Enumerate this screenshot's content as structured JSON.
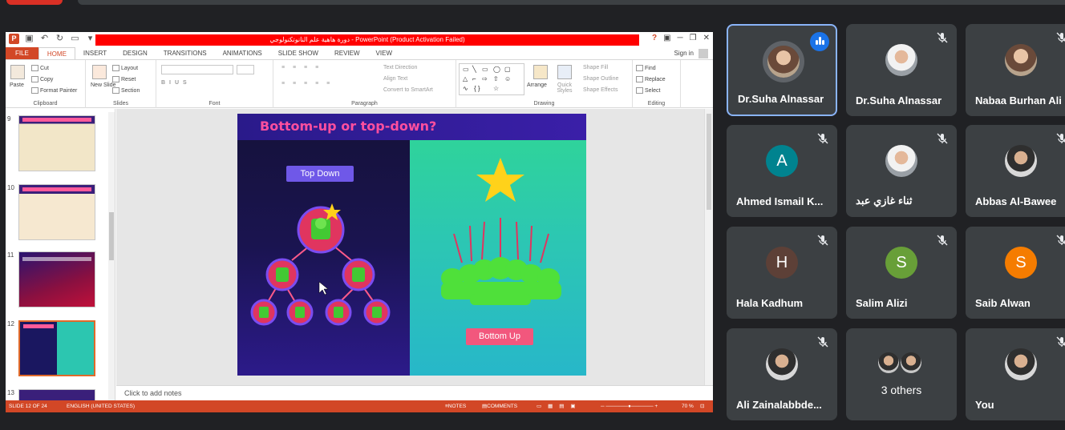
{
  "ppt": {
    "title": "دورة هاهية علم النانوتكنولوجي - PowerPoint (Product Activation Failed)",
    "window_controls": [
      "?",
      "▣",
      "─",
      "❐",
      "✕"
    ],
    "tabs": [
      "FILE",
      "HOME",
      "INSERT",
      "DESIGN",
      "TRANSITIONS",
      "ANIMATIONS",
      "SLIDE SHOW",
      "REVIEW",
      "VIEW"
    ],
    "sign_in": "Sign in",
    "ribbon": {
      "clipboard": {
        "paste": "Paste",
        "cut": "Cut",
        "copy": "Copy",
        "format_painter": "Format Painter",
        "label": "Clipboard"
      },
      "slides": {
        "new_slide": "New Slide",
        "layout": "Layout",
        "reset": "Reset",
        "section": "Section",
        "label": "Slides"
      },
      "font": {
        "label": "Font"
      },
      "paragraph": {
        "text_direction": "Text Direction",
        "align_text": "Align Text",
        "convert": "Convert to SmartArt",
        "label": "Paragraph"
      },
      "drawing": {
        "arrange": "Arrange",
        "quick_styles": "Quick Styles",
        "shape_fill": "Shape Fill",
        "shape_outline": "Shape Outline",
        "shape_effects": "Shape Effects",
        "label": "Drawing"
      },
      "editing": {
        "find": "Find",
        "replace": "Replace",
        "select": "Select",
        "label": "Editing"
      }
    },
    "thumbnails": [
      {
        "num": "9",
        "title": "Classification of Nanomaterials"
      },
      {
        "num": "10",
        "title": "Classification of Nanomaterials"
      },
      {
        "num": "11",
        "title": "Approaches of Nanotechnology"
      },
      {
        "num": "12",
        "title": "Bottom-up or top-down?"
      },
      {
        "num": "13",
        "title": "Types of Nanomaterials"
      }
    ],
    "slide": {
      "title": "Bottom-up or top-down?",
      "top_down": "Top Down",
      "bottom_up": "Bottom Up"
    },
    "notes_placeholder": "Click to add notes",
    "status": {
      "slide_count": "SLIDE 12 OF 24",
      "language": "ENGLISH (UNITED STATES)",
      "notes": "NOTES",
      "comments": "COMMENTS",
      "zoom": "70 %"
    }
  },
  "participants": [
    {
      "name": "Dr.Suha Alnassar",
      "avatar_type": "photo",
      "speaking": true
    },
    {
      "name": "Dr.Suha Alnassar",
      "avatar_type": "photo",
      "muted": true
    },
    {
      "name": "Nabaa Burhan Ali",
      "avatar_type": "photo",
      "muted": true
    },
    {
      "name": "Ahmed Ismail K...",
      "initial": "A",
      "color": "#00838f",
      "muted": true
    },
    {
      "name": "ثناء غازي عبد",
      "avatar_type": "photo",
      "muted": true
    },
    {
      "name": "Abbas Al-Bawee",
      "avatar_type": "photo",
      "muted": true
    },
    {
      "name": "Hala Kadhum",
      "initial": "H",
      "color": "#5d4037",
      "muted": true
    },
    {
      "name": "Salim Alizi",
      "initial": "S",
      "color": "#689f38",
      "muted": true
    },
    {
      "name": "Saib Alwan",
      "initial": "S",
      "color": "#f57c00",
      "muted": true
    },
    {
      "name": "Ali Zainalabbde...",
      "avatar_type": "photo",
      "muted": true
    },
    {
      "name": "3 others",
      "avatar_type": "group"
    },
    {
      "name": "You",
      "avatar_type": "photo",
      "muted": true
    }
  ]
}
